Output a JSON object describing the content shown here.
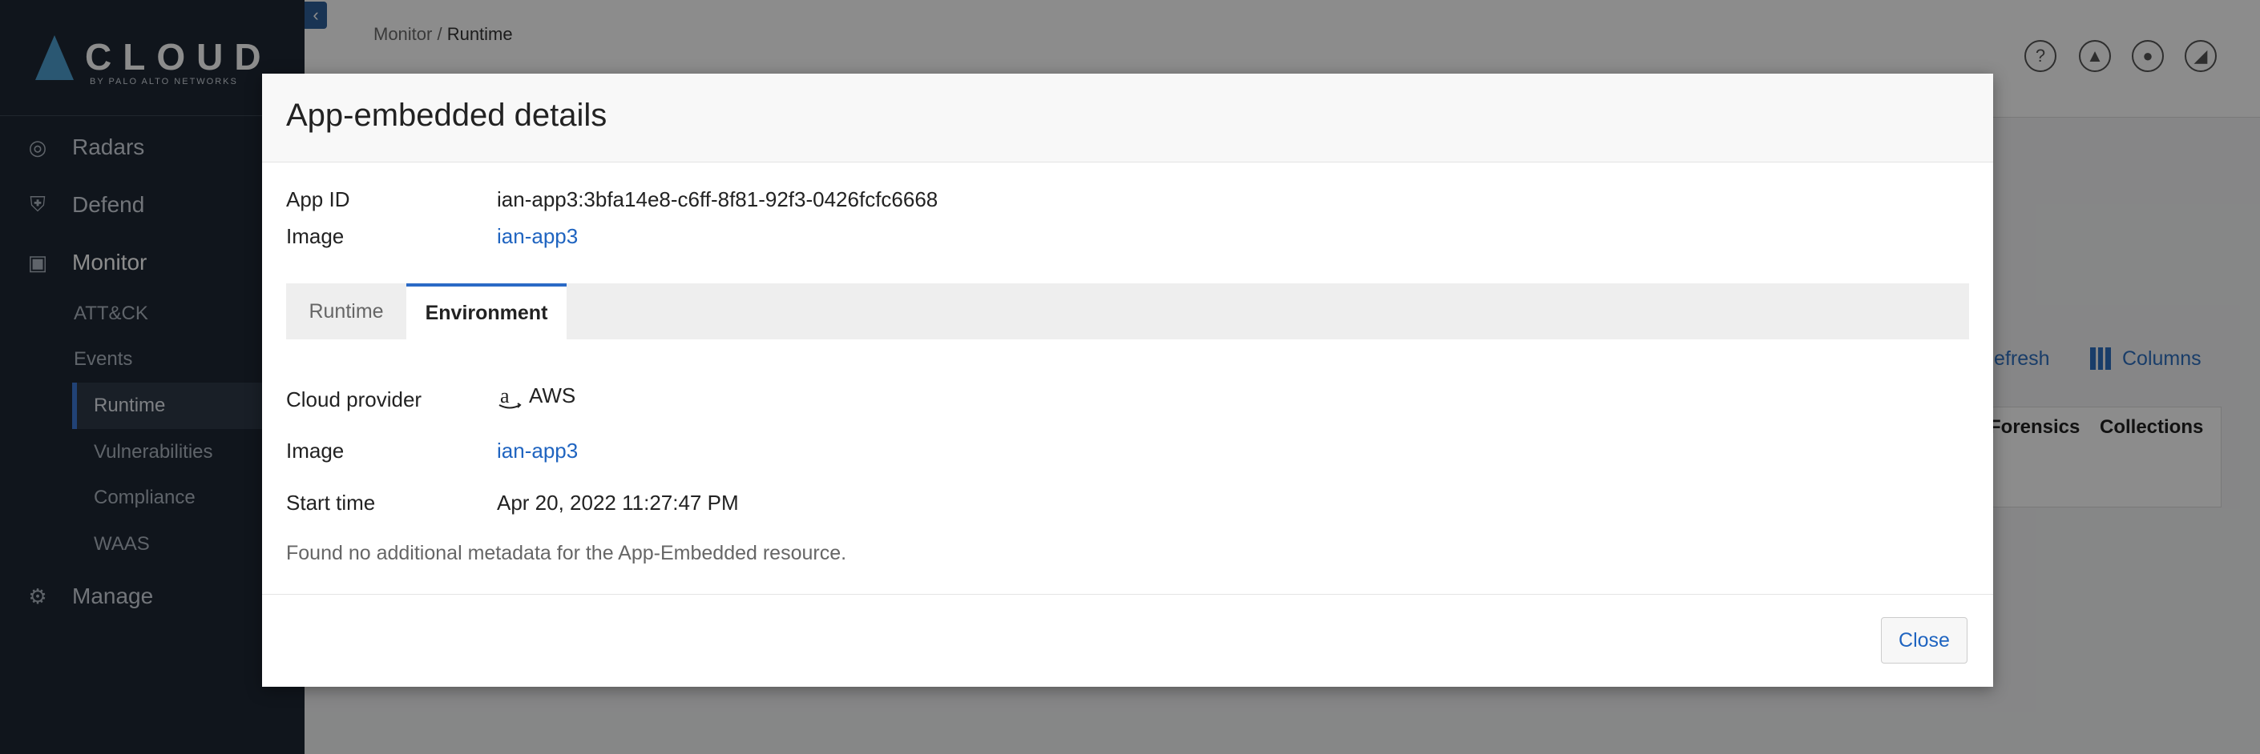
{
  "brand": {
    "word": "CLOUD",
    "sub": "BY PALO ALTO NETWORKS"
  },
  "sidebar": {
    "items": [
      {
        "label": "Radars",
        "icon": "radar-icon"
      },
      {
        "label": "Defend",
        "icon": "shield-icon"
      },
      {
        "label": "Monitor",
        "icon": "monitor-icon"
      },
      {
        "label": "Manage",
        "icon": "gear-icon"
      }
    ],
    "monitor_sub": [
      {
        "label": "ATT&CK"
      },
      {
        "label": "Events"
      },
      {
        "label": "Runtime",
        "active": true
      },
      {
        "label": "Vulnerabilities"
      },
      {
        "label": "Compliance"
      },
      {
        "label": "WAAS"
      }
    ]
  },
  "breadcrumb": {
    "parent": "Monitor",
    "separator": " / ",
    "current": "Runtime"
  },
  "header_icons": [
    "help-icon",
    "bell-icon",
    "user-icon",
    "chart-icon"
  ],
  "background": {
    "refresh_label": "Refresh",
    "columns_label": "Columns",
    "table_headers": [
      "Forensics",
      "Collections"
    ]
  },
  "modal": {
    "title": "App-embedded details",
    "app_id_label": "App ID",
    "app_id_value": "ian-app3:3bfa14e8-c6ff-8f81-92f3-0426fcfc6668",
    "image_label": "Image",
    "image_value": "ian-app3",
    "tabs": [
      {
        "label": "Runtime",
        "active": false
      },
      {
        "label": "Environment",
        "active": true
      }
    ],
    "environment": {
      "cloud_provider_label": "Cloud provider",
      "cloud_provider_value": "AWS",
      "image_label": "Image",
      "image_value": "ian-app3",
      "start_time_label": "Start time",
      "start_time_value": "Apr 20, 2022 11:27:47 PM",
      "note": "Found no additional metadata for the App-Embedded resource."
    },
    "close_label": "Close"
  },
  "colors": {
    "accent": "#1f64c0",
    "sidebar_bg": "#1e2733",
    "active_tab_border": "#2b6ac6"
  }
}
